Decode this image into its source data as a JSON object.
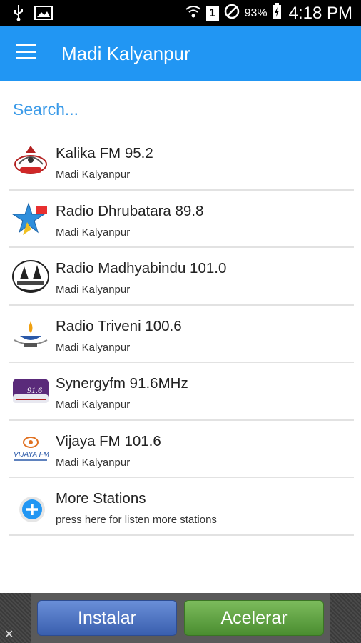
{
  "status_bar": {
    "battery_percent": "93%",
    "time": "4:18 PM",
    "sim_label": "1"
  },
  "app_bar": {
    "title": "Madi Kalyanpur"
  },
  "search": {
    "placeholder": "Search..."
  },
  "stations": [
    {
      "name": "Kalika FM 95.2",
      "location": "Madi Kalyanpur",
      "logo": "kalika-fm-logo"
    },
    {
      "name": "Radio Dhrubatara 89.8",
      "location": "Madi Kalyanpur",
      "logo": "dhrubatara-star-logo"
    },
    {
      "name": "Radio Madhyabindu 101.0",
      "location": "Madi Kalyanpur",
      "logo": "madhyabindu-logo"
    },
    {
      "name": "Radio Triveni 100.6",
      "location": "Madi Kalyanpur",
      "logo": "triveni-lamp-logo"
    },
    {
      "name": "Synergyfm 91.6MHz",
      "location": "Madi Kalyanpur",
      "logo": "synergy-fm-logo"
    },
    {
      "name": "Vijaya FM 101.6",
      "location": "Madi Kalyanpur",
      "logo": "vijaya-fm-logo"
    }
  ],
  "more": {
    "title": "More Stations",
    "subtitle": "press here for listen more stations",
    "icon": "plus-circle-icon"
  },
  "ad": {
    "install_label": "Instalar",
    "accelerate_label": "Acelerar",
    "close_glyph": "✕"
  },
  "logo_text": {
    "synergy": "91.6",
    "vijaya": "VIJAYA FM"
  },
  "colors": {
    "app_bar": "#2196f3",
    "search_text": "#3a9ae8",
    "install": "#3a5fae",
    "accelerate": "#4a8d30"
  }
}
